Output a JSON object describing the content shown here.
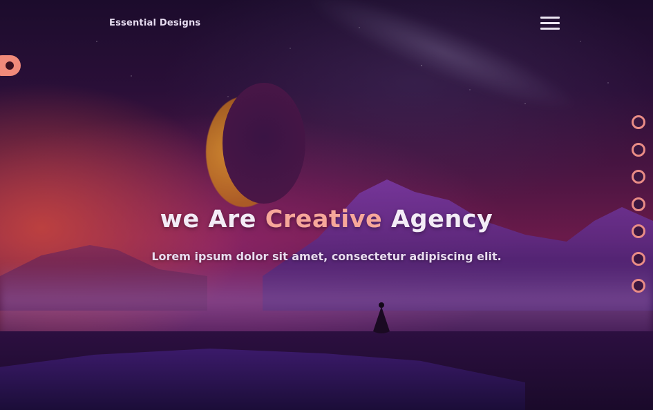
{
  "header": {
    "brand": "Essential Designs",
    "menu_icon": "hamburger-menu-icon"
  },
  "hero": {
    "title_start": "we Are ",
    "title_accent": "Creative",
    "title_end": " Agency",
    "subtitle": "Lorem ipsum dolor sit amet, consectetur adipiscing elit."
  },
  "side_toggle": {
    "icon": "dot-icon"
  },
  "pager": {
    "count": 7,
    "icon": "circle-dot-icon"
  },
  "colors": {
    "accent": "#f7a79a",
    "pager_ring": "#e98c86",
    "toggle": "#f08a7a",
    "text": "#f3ecf6"
  }
}
